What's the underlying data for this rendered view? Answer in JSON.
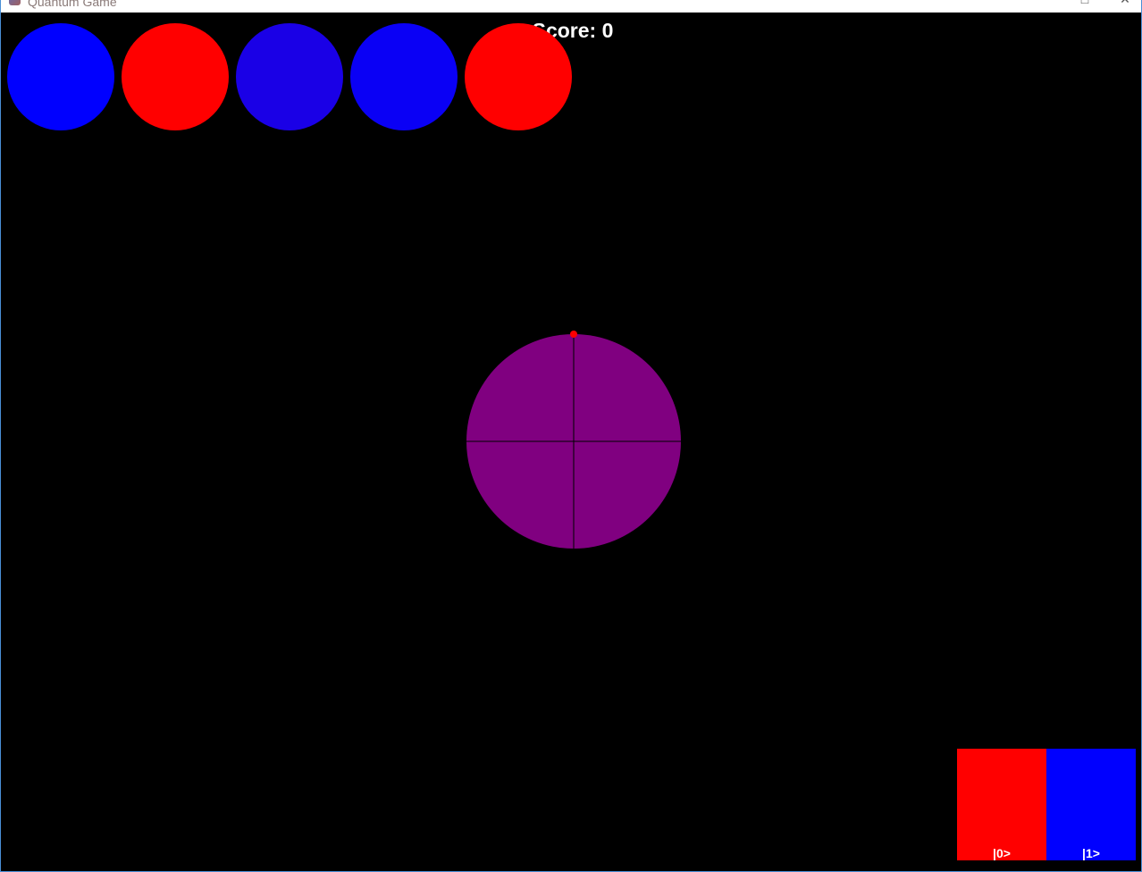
{
  "window": {
    "title": "Quantum Game",
    "icon": "app-icon",
    "maximize_glyph": "□",
    "close_glyph": "✕"
  },
  "hud": {
    "score_label": "Score: 0"
  },
  "queue": [
    {
      "color": "#0000ff"
    },
    {
      "color": "#ff0000"
    },
    {
      "color": "#1a00e6"
    },
    {
      "color": "#0a00f5"
    },
    {
      "color": "#ff0000"
    }
  ],
  "qubit": {
    "fill": "#800080",
    "axis_color": "#000000",
    "state_marker_color": "#ff0000"
  },
  "targets": [
    {
      "label": "|0>",
      "color": "#ff0000"
    },
    {
      "label": "|1>",
      "color": "#0000ff"
    }
  ]
}
